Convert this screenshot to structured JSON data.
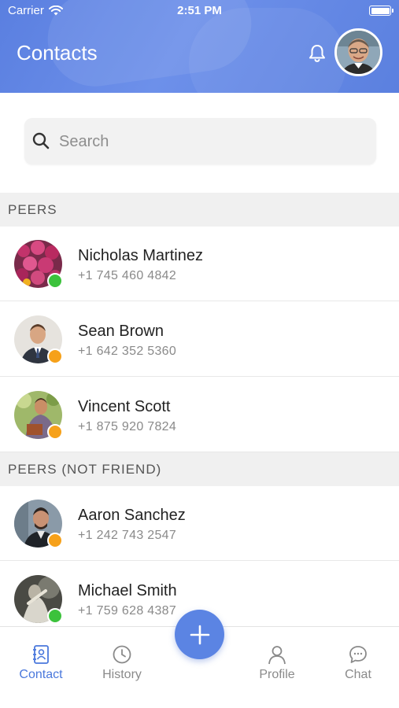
{
  "status_bar": {
    "carrier": "Carrier",
    "time": "2:51 PM"
  },
  "header": {
    "title": "Contacts"
  },
  "search": {
    "placeholder": "Search"
  },
  "sections": [
    {
      "title": "PEERS",
      "contacts": [
        {
          "name": "Nicholas Martinez",
          "phone": "+1 745 460 4842",
          "status": "online"
        },
        {
          "name": "Sean Brown",
          "phone": "+1 642 352 5360",
          "status": "away"
        },
        {
          "name": "Vincent Scott",
          "phone": "+1 875 920 7824",
          "status": "away"
        }
      ]
    },
    {
      "title": "PEERS (NOT FRIEND)",
      "contacts": [
        {
          "name": "Aaron Sanchez",
          "phone": "+1 242 743 2547",
          "status": "away"
        },
        {
          "name": "Michael Smith",
          "phone": "+1 759 628 4387",
          "status": "online"
        }
      ]
    }
  ],
  "tabbar": {
    "items": [
      {
        "label": "Contact",
        "icon": "contact-book-icon",
        "active": true
      },
      {
        "label": "History",
        "icon": "clock-icon",
        "active": false
      },
      {
        "label": "Profile",
        "icon": "person-icon",
        "active": false
      },
      {
        "label": "Chat",
        "icon": "chat-bubble-icon",
        "active": false
      }
    ]
  },
  "colors": {
    "accent": "#5b84e3",
    "online": "#3cc23c",
    "away": "#f6a11a"
  }
}
